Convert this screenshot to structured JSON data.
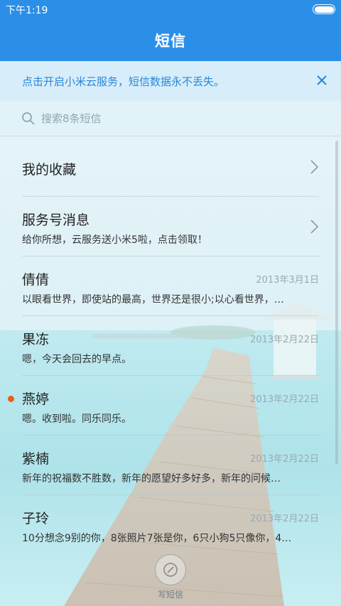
{
  "status": {
    "time": "下午1:19"
  },
  "header": {
    "title": "短信"
  },
  "banner": {
    "text": "点击开启小米云服务，短信数据永不丢失。"
  },
  "search": {
    "placeholder": "搜索8条短信"
  },
  "items": [
    {
      "name": "我的收藏",
      "preview": "",
      "date": "",
      "chevron": true,
      "unread": false
    },
    {
      "name": "服务号消息",
      "preview": "给你所想，云服务送小米5啦，点击领取！",
      "date": "",
      "chevron": true,
      "unread": false
    },
    {
      "name": "倩倩",
      "preview": "以眼看世界，即使站的最高，世界还是很小;以心看世界，…",
      "date": "2013年3月1日",
      "chevron": false,
      "unread": false
    },
    {
      "name": "果冻",
      "preview": "嗯，今天会回去的早点。",
      "date": "2013年2月22日",
      "chevron": false,
      "unread": false
    },
    {
      "name": "燕婷",
      "preview": "嗯。收到啦。同乐同乐。",
      "date": "2013年2月22日",
      "chevron": false,
      "unread": true
    },
    {
      "name": "紫楠",
      "preview": "新年的祝福数不胜数，新年的愿望好多好多，新年的问候…",
      "date": "2013年2月22日",
      "chevron": false,
      "unread": false
    },
    {
      "name": "子玲",
      "preview": "10分想念9别的你，8张照片7张是你，6只小狗5只像你，4…",
      "date": "2013年2月22日",
      "chevron": false,
      "unread": false
    }
  ],
  "compose": {
    "label": "写短信"
  },
  "colors": {
    "accent": "#2b8fe8",
    "banner_text": "#2a86d8",
    "unread_dot": "#f05a1a"
  }
}
